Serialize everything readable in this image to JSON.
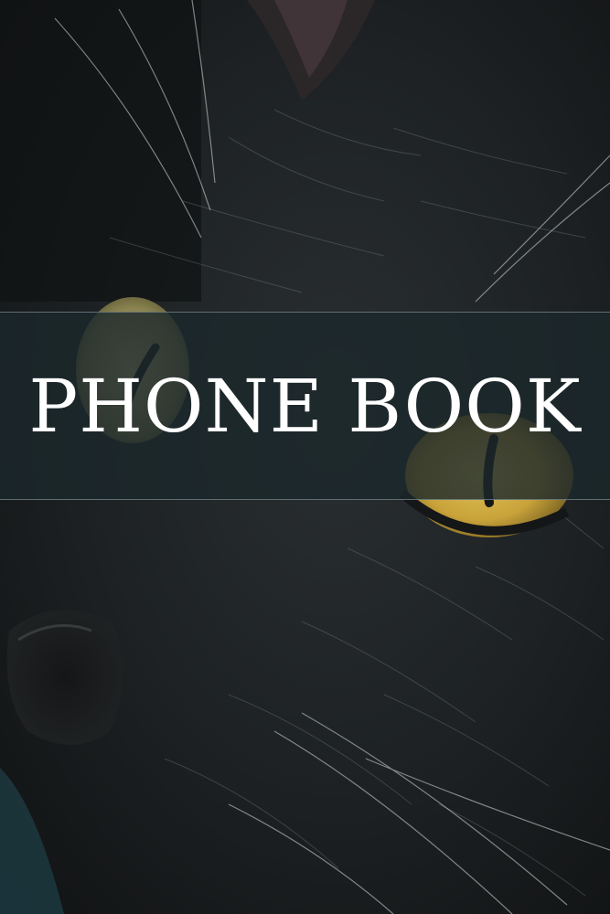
{
  "book": {
    "title": "PHONE BOOK"
  },
  "artwork": {
    "subject": "black-cat-face-closeup",
    "colors": {
      "fur": "#1e2224",
      "fur_highlight": "#8a9090",
      "eye": "#c9a23a",
      "band": "#1b282c",
      "title_text": "#ffffff"
    }
  }
}
